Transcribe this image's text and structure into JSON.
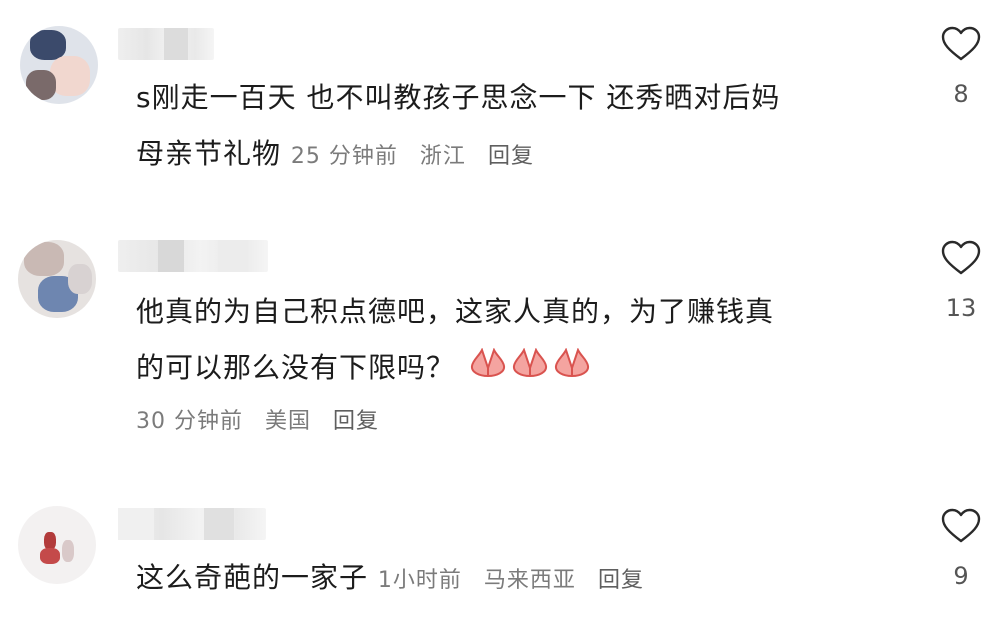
{
  "comments": [
    {
      "lines": [
        "s刚走一百天 也不叫教孩子思念一下 还秀晒对后妈",
        "母亲节礼物"
      ],
      "time": "25 分钟前",
      "location": "浙江",
      "reply_label": "回复",
      "likes": "8"
    },
    {
      "lines": [
        "他真的为自己积点德吧，这家人真的，为了赚钱真",
        "的可以那么没有下限吗？"
      ],
      "emoji": [
        "folded-hands",
        "folded-hands",
        "folded-hands"
      ],
      "time": "30 分钟前",
      "location": "美国",
      "reply_label": "回复",
      "likes": "13"
    },
    {
      "lines": [
        "这么奇葩的一家子"
      ],
      "time": "1小时前",
      "location": "马来西亚",
      "reply_label": "回复",
      "likes": "9"
    }
  ],
  "icons": {
    "like": "heart-outline-icon",
    "emoji": "folded-hands-emoji"
  },
  "colors": {
    "text": "#1c1c1c",
    "meta": "#7b7b7b",
    "emoji": "#e0615f"
  }
}
